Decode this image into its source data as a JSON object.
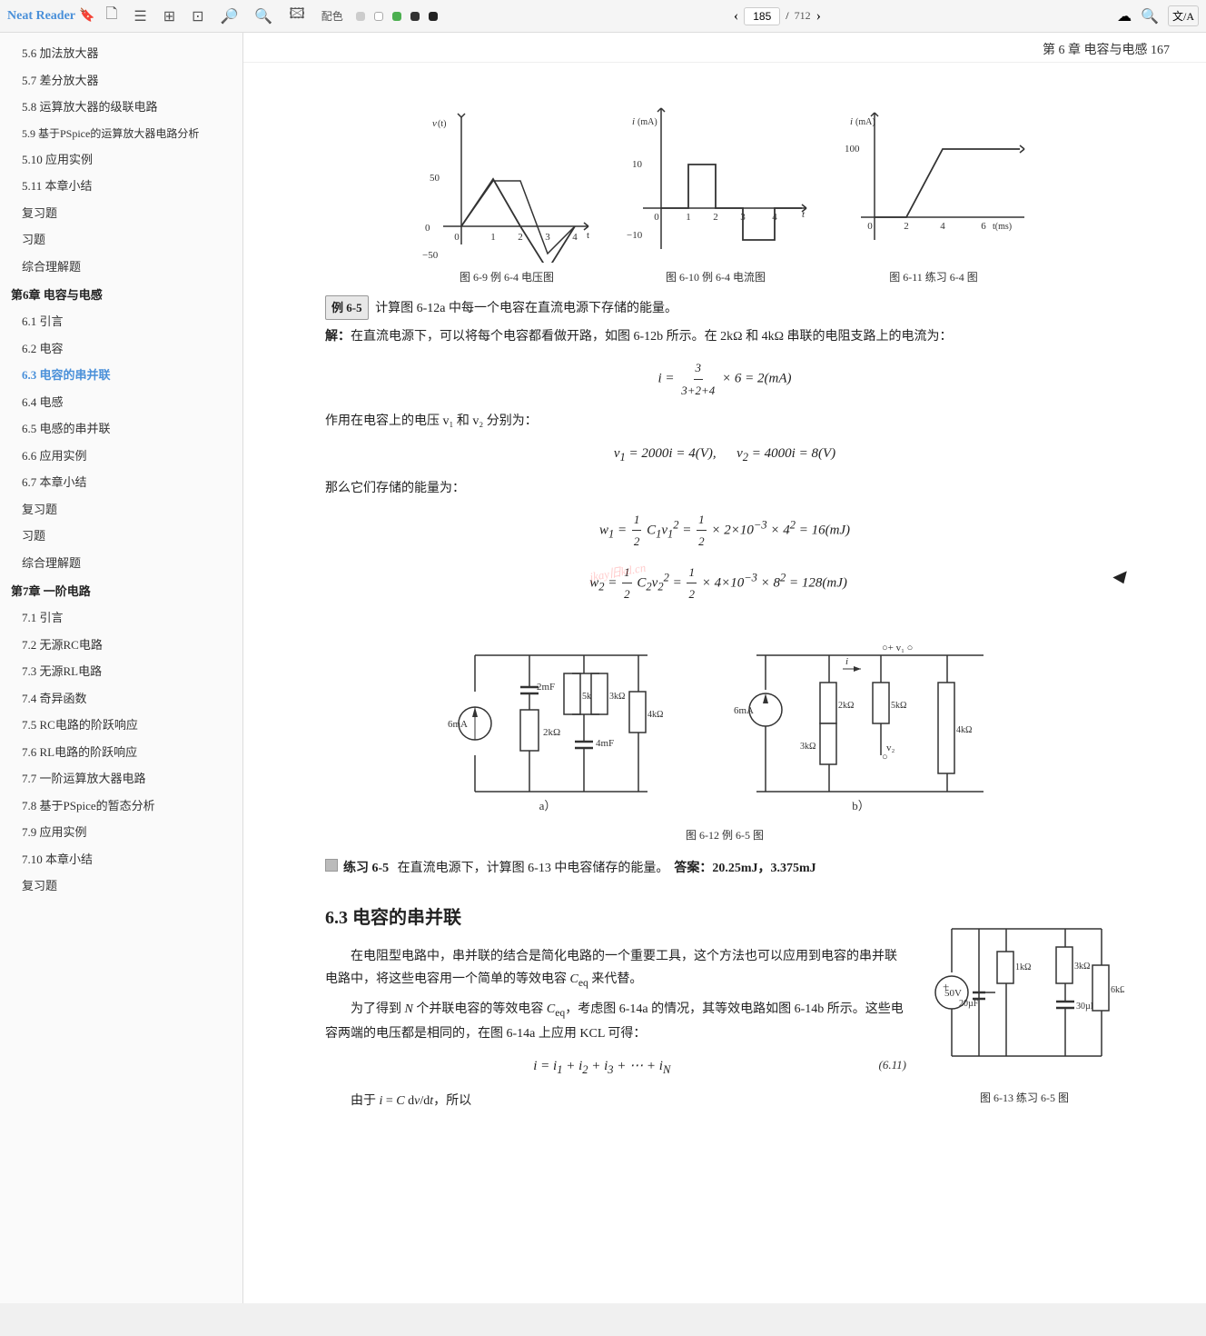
{
  "app": {
    "title": "Neat Reader",
    "page_current": "185",
    "page_total": "712"
  },
  "topbar": {
    "icons": [
      "🖹",
      "☰",
      "⊞",
      "⊡",
      "🔍",
      "🔍",
      "🖾"
    ],
    "color_label": "配色",
    "color_dots": [
      "#ccc",
      "#fff",
      "#4CAF50",
      "#333",
      "#555"
    ],
    "nav_prev": "‹",
    "nav_next": "›",
    "right_icons": [
      "☁",
      "🔍",
      "文/A"
    ]
  },
  "sidebar": {
    "items": [
      {
        "label": "5.6  加法放大器",
        "indent": 1
      },
      {
        "label": "5.7  差分放大器",
        "indent": 1
      },
      {
        "label": "5.8  运算放大器的级联电路",
        "indent": 1
      },
      {
        "label": "5.9  基于PSpice的运算放大器电路分析",
        "indent": 1
      },
      {
        "label": "5.10  应用实例",
        "indent": 1
      },
      {
        "label": "5.11  本章小结",
        "indent": 1
      },
      {
        "label": "复习题",
        "indent": 1
      },
      {
        "label": "习题",
        "indent": 1
      },
      {
        "label": "综合理解题",
        "indent": 1
      },
      {
        "label": "第6章  电容与电感",
        "indent": 0,
        "section": true
      },
      {
        "label": "6.1  引言",
        "indent": 1
      },
      {
        "label": "6.2  电容",
        "indent": 1
      },
      {
        "label": "6.3  电容的串并联",
        "indent": 1,
        "active": true
      },
      {
        "label": "6.4  电感",
        "indent": 1
      },
      {
        "label": "6.5  电感的串并联",
        "indent": 1
      },
      {
        "label": "6.6  应用实例",
        "indent": 1
      },
      {
        "label": "6.7  本章小结",
        "indent": 1
      },
      {
        "label": "复习题",
        "indent": 1
      },
      {
        "label": "习题",
        "indent": 1
      },
      {
        "label": "综合理解题",
        "indent": 1
      },
      {
        "label": "第7章  一阶电路",
        "indent": 0,
        "section": true
      },
      {
        "label": "7.1  引言",
        "indent": 1
      },
      {
        "label": "7.2  无源RC电路",
        "indent": 1
      },
      {
        "label": "7.3  无源RL电路",
        "indent": 1
      },
      {
        "label": "7.4  奇异函数",
        "indent": 1
      },
      {
        "label": "7.5  RC电路的阶跃响应",
        "indent": 1
      },
      {
        "label": "7.6  RL电路的阶跃响应",
        "indent": 1
      },
      {
        "label": "7.7  一阶运算放大器电路",
        "indent": 1
      },
      {
        "label": "7.8  基于PSpice的暂态分析",
        "indent": 1
      },
      {
        "label": "7.9  应用实例",
        "indent": 1
      },
      {
        "label": "7.10  本章小结",
        "indent": 1
      },
      {
        "label": "复习题",
        "indent": 1
      }
    ]
  },
  "page": {
    "chapter_header": "第 6 章   电容与电感   167",
    "example_65_label": "例 6-5",
    "example_65_text": "计算图 6-12a 中每一个电容在直流电源下存储的能量。",
    "solution_text": "解：在直流电源下，可以将每个电容都看做开路，如图 6-12b 所示。在 2kΩ 和 4kΩ 串联的电阻支路上的电流为：",
    "formula_i": "i = 3 / (3+2+4) × 6 = 2(mA)",
    "voltage_text": "作用在电容上的电压 v₁ 和 v₂ 分别为：",
    "formula_v": "v₁ = 2000i = 4(V),     v₂ = 4000i = 8(V)",
    "energy_text": "那么它们存储的能量为：",
    "formula_w1": "w₁ = ½C₁v₁² = ½ × 2×10⁻³ × 4² = 16(mJ)",
    "formula_w2": "w₂ = ½C₂v₂² = ½ × 4×10⁻³ × 8² = 128(mJ)",
    "fig612_caption": "图 6-12   例 6-5 图",
    "fig612a_label": "a）",
    "fig612b_label": "b）",
    "practice_65_label": "练习 6-5",
    "practice_65_text": "在直流电源下，计算图 6-13 中电容储存的能量。",
    "practice_65_answer": "答案：20.25mJ，3.375mJ",
    "section_63": "6.3   电容的串并联",
    "para1": "在电阻型电路中，串并联的结合是简化电路的一个重要工具，这个方法也可以应用到电容的串并联电路中，将这些电容用一个简单的等效电容 C_eq 来代替。",
    "para2": "为了得到 N 个并联电容的等效电容 C_eq，考虑图 6-14a 的情况，其等效电路如图 6-14b 所示。这些电容两端的电压都是相同的，在图 6-14a 上应用 KCL 可得：",
    "formula_kcl": "i = i₁ + i₂ + i₃ + ⋯ + iₙ",
    "eq_num": "(6.11)",
    "next_line": "由于 i = C dv/dt，所以",
    "fig613_caption": "图 6-13   练习 6-5 图",
    "fig69_caption": "图 6-9   例 6-4 电压图",
    "fig610_caption": "图 6-10   例 6-4 电流图",
    "fig611_caption": "图 6-11   练习 6-4 图"
  }
}
